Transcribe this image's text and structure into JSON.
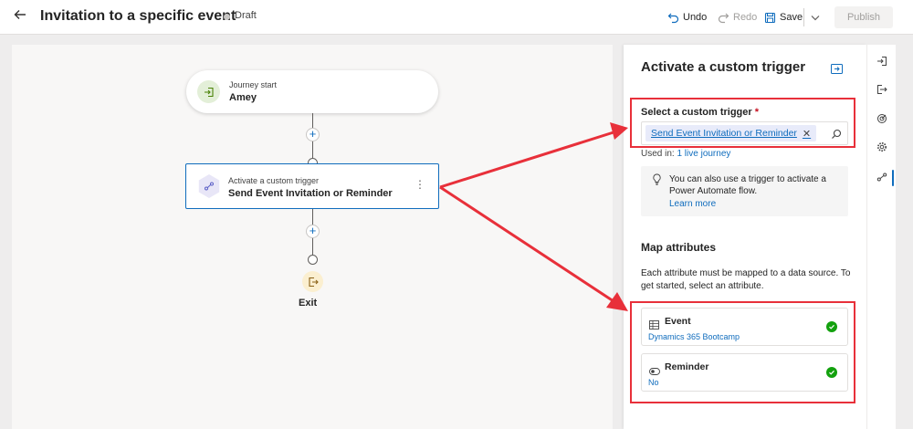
{
  "header": {
    "title": "Invitation to a specific event",
    "status": "Draft",
    "undo_label": "Undo",
    "redo_label": "Redo",
    "save_label": "Save",
    "publish_label": "Publish"
  },
  "canvas": {
    "start_node": {
      "caption": "Journey start",
      "name": "Amey"
    },
    "trigger_node": {
      "caption": "Activate a custom trigger",
      "name": "Send Event Invitation or Reminder"
    },
    "exit_label": "Exit"
  },
  "panel": {
    "title": "Activate a custom trigger",
    "select_label": "Select a custom trigger",
    "required_mark": "*",
    "selected_trigger": "Send Event Invitation or Reminder",
    "used_in_prefix": "Used in:",
    "used_in_link": "1 live journey",
    "tip_text": "You can also use a trigger to activate a Power Automate flow.",
    "tip_link": "Learn more",
    "map_title": "Map attributes",
    "map_desc": "Each attribute must be mapped to a data source. To get started, select an attribute.",
    "attributes": [
      {
        "name": "Event",
        "value": "Dynamics 365 Bootcamp",
        "icon": "table-icon"
      },
      {
        "name": "Reminder",
        "value": "No",
        "icon": "toggle-icon"
      }
    ]
  },
  "rail": {
    "icons": [
      "enter-icon",
      "exit-icon",
      "target-icon",
      "settings-icon",
      "trigger-icon"
    ]
  },
  "colors": {
    "accent": "#0f6cbd",
    "annotation": "#e8303a",
    "success": "#13a10e"
  }
}
